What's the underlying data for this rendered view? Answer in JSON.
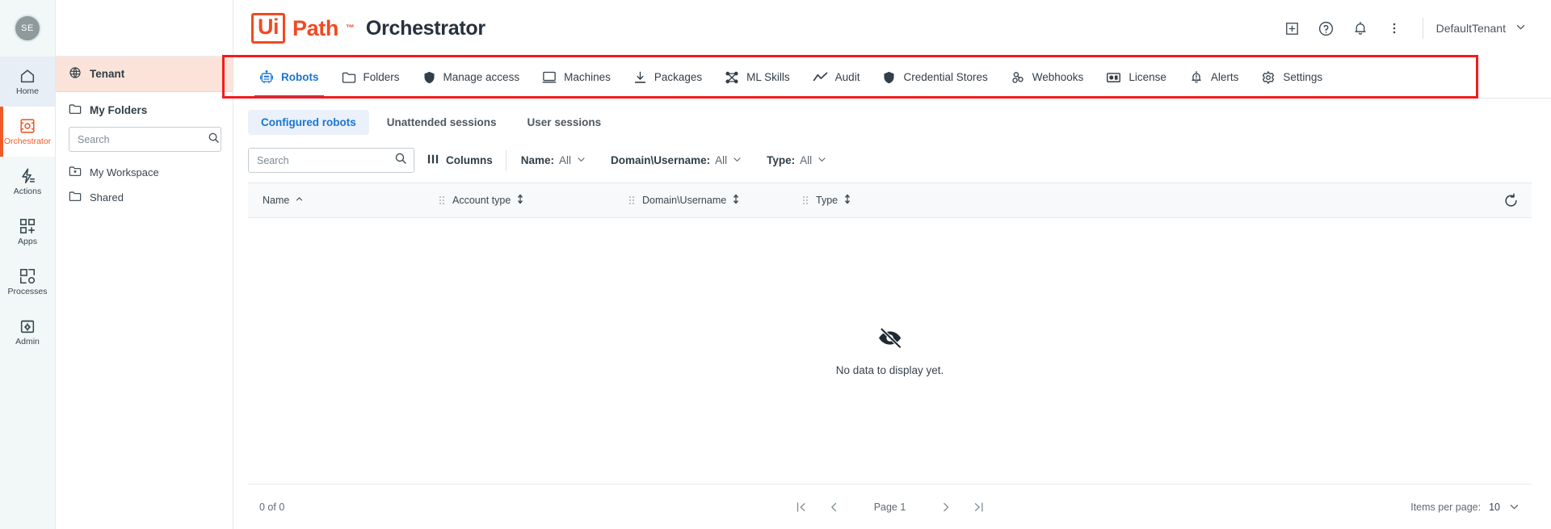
{
  "rail": {
    "avatar_initials": "SE",
    "items": [
      {
        "label": "Home",
        "icon": "home-icon",
        "state": "hover"
      },
      {
        "label": "Orchestrator",
        "icon": "orchestrator-icon",
        "state": "active"
      },
      {
        "label": "Actions",
        "icon": "actions-icon",
        "state": "normal"
      },
      {
        "label": "Apps",
        "icon": "apps-icon",
        "state": "normal"
      },
      {
        "label": "Processes",
        "icon": "processes-icon",
        "state": "normal"
      },
      {
        "label": "Admin",
        "icon": "admin-icon",
        "state": "normal"
      }
    ]
  },
  "header": {
    "brand_ui": "Ui",
    "brand_path": "Path",
    "brand_tm": "™",
    "brand_product": "Orchestrator",
    "icons": [
      {
        "name": "add-icon",
        "title": "Add"
      },
      {
        "name": "help-icon",
        "title": "Help"
      },
      {
        "name": "notifications-bell-icon",
        "title": "Notifications"
      },
      {
        "name": "more-vertical-icon",
        "title": "More"
      }
    ],
    "tenant_name": "DefaultTenant"
  },
  "folder_panel": {
    "tenant_label": "Tenant",
    "my_folders_label": "My Folders",
    "search_placeholder": "Search",
    "search_value": "",
    "folders": [
      {
        "label": "My Workspace",
        "icon": "workspace-folder-icon"
      },
      {
        "label": "Shared",
        "icon": "folder-icon"
      }
    ]
  },
  "nav_tabs": [
    {
      "label": "Robots",
      "icon": "robot-icon",
      "active": true
    },
    {
      "label": "Folders",
      "icon": "folder-icon",
      "active": false
    },
    {
      "label": "Manage access",
      "icon": "shield-icon",
      "active": false
    },
    {
      "label": "Machines",
      "icon": "monitor-icon",
      "active": false
    },
    {
      "label": "Packages",
      "icon": "download-icon",
      "active": false
    },
    {
      "label": "ML Skills",
      "icon": "ml-skills-icon",
      "active": false
    },
    {
      "label": "Audit",
      "icon": "trend-line-icon",
      "active": false
    },
    {
      "label": "Credential Stores",
      "icon": "shield-icon",
      "active": false
    },
    {
      "label": "Webhooks",
      "icon": "webhook-icon",
      "active": false
    },
    {
      "label": "License",
      "icon": "license-icon",
      "active": false
    },
    {
      "label": "Alerts",
      "icon": "alert-bell-icon",
      "active": false
    },
    {
      "label": "Settings",
      "icon": "gear-icon",
      "active": false
    }
  ],
  "sub_tabs": [
    {
      "label": "Configured robots",
      "active": true
    },
    {
      "label": "Unattended sessions",
      "active": false
    },
    {
      "label": "User sessions",
      "active": false
    }
  ],
  "filter_bar": {
    "search_placeholder": "Search",
    "search_value": "",
    "columns_label": "Columns",
    "filters": [
      {
        "label": "Name:",
        "value": "All"
      },
      {
        "label": "Domain\\Username:",
        "value": "All"
      },
      {
        "label": "Type:",
        "value": "All"
      }
    ]
  },
  "table": {
    "columns": [
      {
        "label": "Name",
        "sort": "asc"
      },
      {
        "label": "Account type",
        "sort": "none"
      },
      {
        "label": "Domain\\Username",
        "sort": "none"
      },
      {
        "label": "Type",
        "sort": "none"
      }
    ],
    "rows": [],
    "empty_text": "No data to display yet.",
    "empty_icon": "eye-off-icon",
    "refresh_icon": "refresh-icon"
  },
  "footer": {
    "count_label": "0 of 0",
    "page_label": "Page 1",
    "items_per_page_label": "Items per page:",
    "items_per_page_value": "10"
  },
  "annotation": {
    "color": "#f41c1c"
  }
}
